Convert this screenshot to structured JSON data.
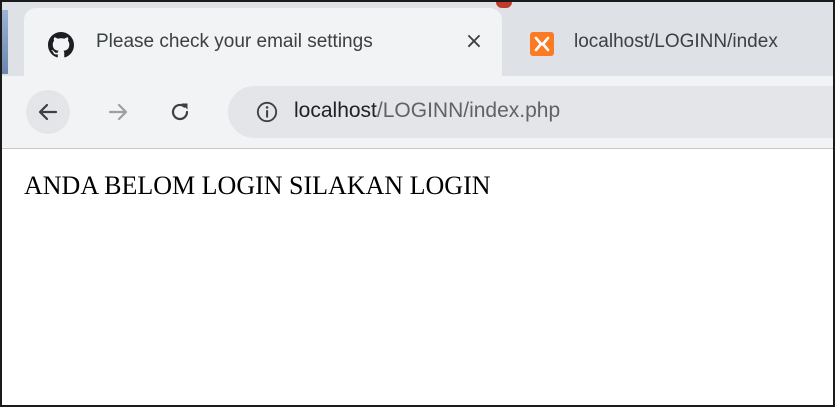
{
  "browser": {
    "tabs": [
      {
        "title": "Please check your email settings",
        "favicon": "github-icon",
        "active": true,
        "close_label": "×"
      },
      {
        "title": "localhost/LOGINN/index",
        "favicon": "xampp-icon",
        "active": false
      }
    ],
    "toolbar": {
      "back_icon": "arrow-left-icon",
      "forward_icon": "arrow-right-icon",
      "reload_icon": "reload-icon",
      "site_info_icon": "info-icon"
    },
    "address_bar": {
      "host": "localhost",
      "path": "/LOGINN/index.php"
    },
    "colors": {
      "tabstrip_bg": "#dee1e6",
      "toolbar_bg": "#f1f3f4",
      "omnibox_bg": "#e3e5e8",
      "xampp_orange": "#fb7a24"
    }
  },
  "page": {
    "body_text": "ANDA BELOM LOGIN SILAKAN LOGIN"
  }
}
